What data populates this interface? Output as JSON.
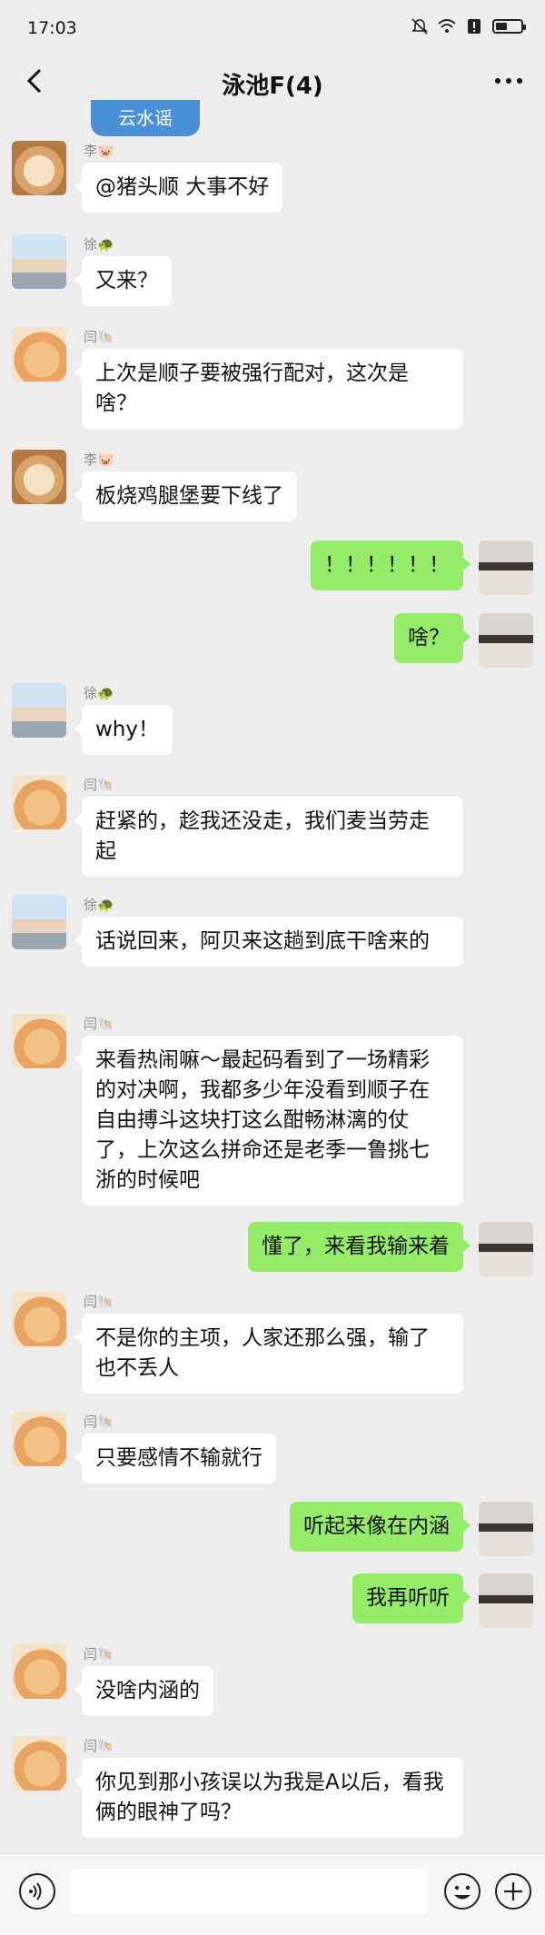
{
  "status": {
    "time": "17:03"
  },
  "header": {
    "title": "泳池F(4)",
    "banner_text": "云水谣"
  },
  "messages": [
    {
      "side": "in",
      "sender": "李🐷",
      "avatar": "dog",
      "text": "@猪头顺 大事不好"
    },
    {
      "side": "in",
      "sender": "徐🐢",
      "avatar": "cyclist",
      "text": "又来？"
    },
    {
      "side": "in",
      "sender": "闫🐚",
      "avatar": "cat",
      "text": "上次是顺子要被强行配对，这次是啥？"
    },
    {
      "side": "in",
      "sender": "李🐷",
      "avatar": "dog",
      "text": "板烧鸡腿堡要下线了"
    },
    {
      "side": "out",
      "avatar": "me",
      "text": "！！！！！！"
    },
    {
      "side": "out",
      "avatar": "me",
      "text": "啥？"
    },
    {
      "side": "in",
      "sender": "徐🐢",
      "avatar": "cyclist",
      "text": "why！"
    },
    {
      "side": "in",
      "sender": "闫🐚",
      "avatar": "cat",
      "text": "赶紧的，趁我还没走，我们麦当劳走起"
    },
    {
      "side": "in",
      "sender": "徐🐢",
      "avatar": "cyclist",
      "text": "话说回来，阿贝来这趟到底干啥来的"
    },
    {
      "side": "in",
      "sender": "闫🐚",
      "avatar": "cat",
      "text": "来看热闹嘛～最起码看到了一场精彩的对决啊，我都多少年没看到顺子在自由搏斗这块打这么酣畅淋漓的仗了，上次这么拼命还是老季一鲁挑七浙的时候吧"
    },
    {
      "side": "out",
      "avatar": "me",
      "text": "懂了，来看我输来着"
    },
    {
      "side": "in",
      "sender": "闫🐚",
      "avatar": "cat",
      "text": "不是你的主项，人家还那么强，输了也不丢人"
    },
    {
      "side": "in",
      "sender": "闫🐚",
      "avatar": "cat",
      "text": "只要感情不输就行"
    },
    {
      "side": "out",
      "avatar": "me",
      "text": "听起来像在内涵"
    },
    {
      "side": "out",
      "avatar": "me",
      "text": "我再听听"
    },
    {
      "side": "in",
      "sender": "闫🐚",
      "avatar": "cat",
      "text": "没啥内涵的"
    },
    {
      "side": "in",
      "sender": "闫🐚",
      "avatar": "cat",
      "text": "你见到那小孩误以为我是A以后，看我俩的眼神了吗？"
    }
  ]
}
